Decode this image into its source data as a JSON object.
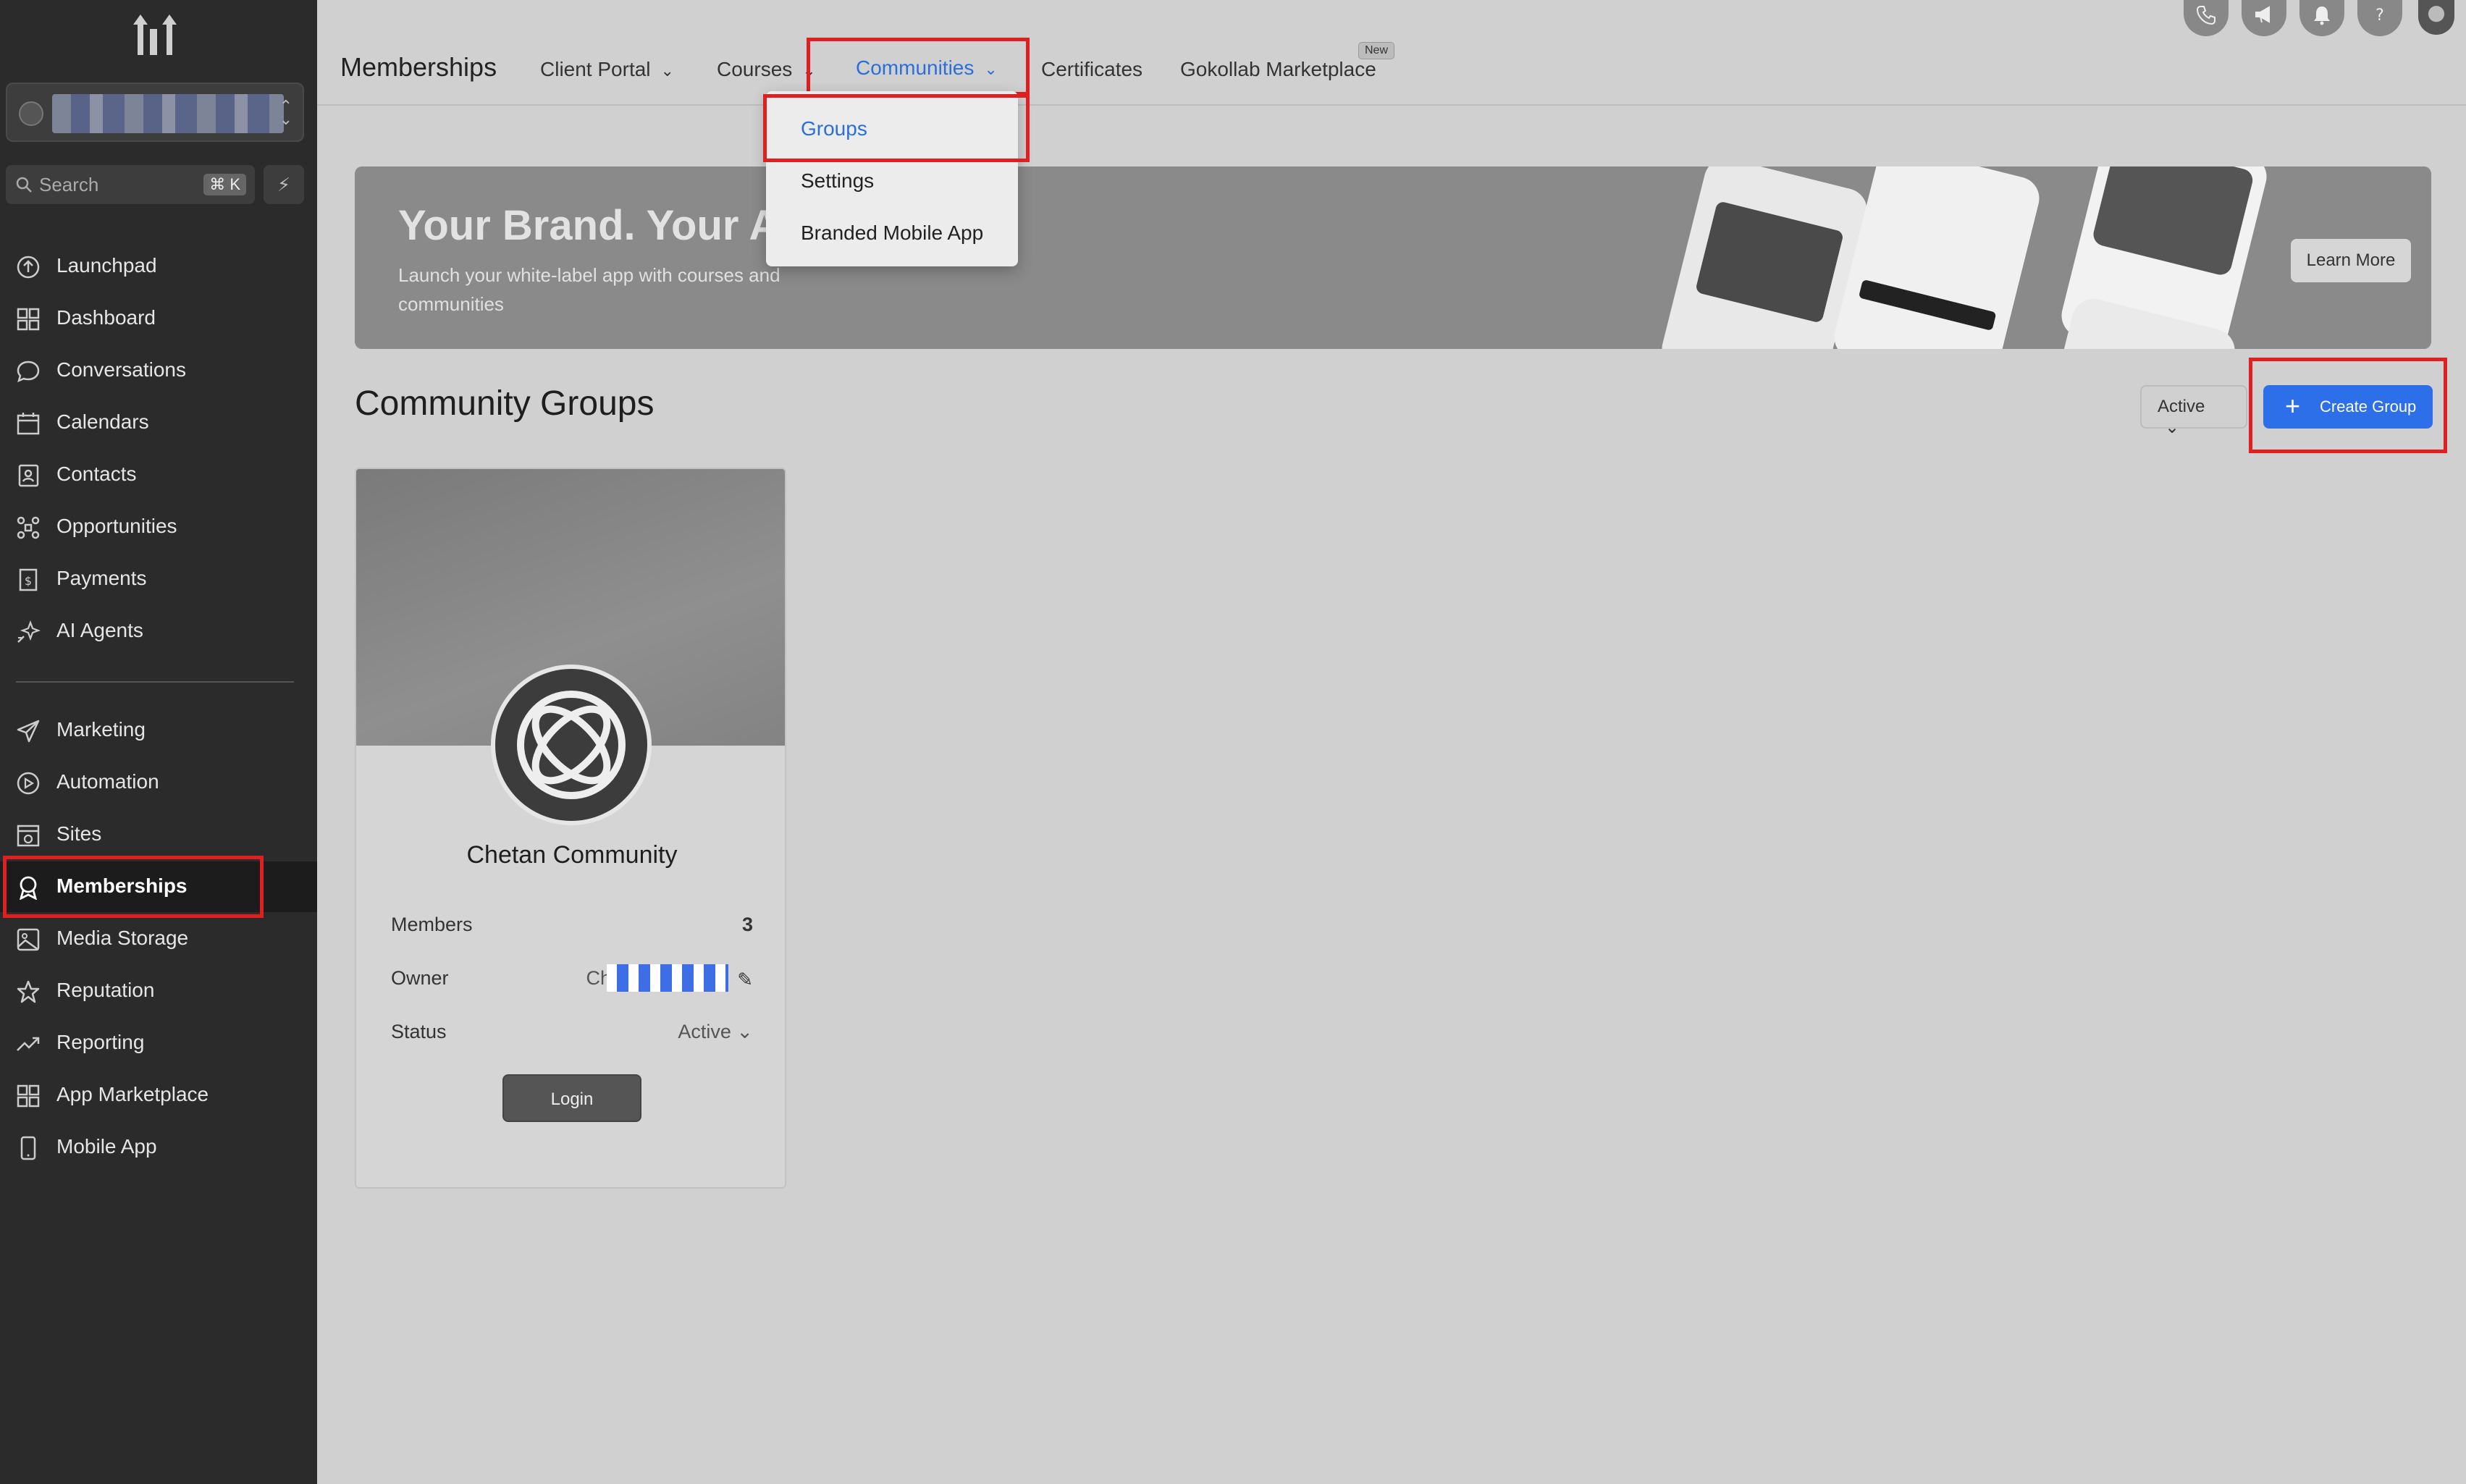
{
  "sidebar": {
    "search_placeholder": "Search",
    "search_shortcut": "⌘ K",
    "items": [
      {
        "label": "Launchpad",
        "icon": "launchpad-icon"
      },
      {
        "label": "Dashboard",
        "icon": "dashboard-icon"
      },
      {
        "label": "Conversations",
        "icon": "chat-icon"
      },
      {
        "label": "Calendars",
        "icon": "calendar-icon"
      },
      {
        "label": "Contacts",
        "icon": "contacts-icon"
      },
      {
        "label": "Opportunities",
        "icon": "opportunities-icon"
      },
      {
        "label": "Payments",
        "icon": "payments-icon"
      },
      {
        "label": "AI Agents",
        "icon": "ai-agents-icon"
      },
      {
        "label": "Marketing",
        "icon": "send-icon"
      },
      {
        "label": "Automation",
        "icon": "automation-icon"
      },
      {
        "label": "Sites",
        "icon": "sites-icon"
      },
      {
        "label": "Memberships",
        "icon": "award-icon",
        "active": true
      },
      {
        "label": "Media Storage",
        "icon": "image-icon"
      },
      {
        "label": "Reputation",
        "icon": "star-icon"
      },
      {
        "label": "Reporting",
        "icon": "trend-icon"
      },
      {
        "label": "App Marketplace",
        "icon": "grid-icon"
      },
      {
        "label": "Mobile App",
        "icon": "mobile-icon"
      }
    ]
  },
  "header": {
    "title": "Memberships",
    "tabs": [
      {
        "label": "Client Portal"
      },
      {
        "label": "Courses"
      },
      {
        "label": "Communities",
        "selected": true
      },
      {
        "label": "Certificates"
      },
      {
        "label": "Gokollab Marketplace",
        "badge": "New"
      }
    ]
  },
  "dropdown": {
    "items": [
      {
        "label": "Groups",
        "selected": true
      },
      {
        "label": "Settings"
      },
      {
        "label": "Branded Mobile App"
      }
    ]
  },
  "banner": {
    "title": "Your Brand. Your App",
    "subtitle": "Launch your white-label app with courses and communities",
    "cta": "Learn More"
  },
  "main": {
    "section_title": "Community Groups",
    "filter_value": "Active",
    "create_label": "Create Group",
    "groups": [
      {
        "name": "Chetan Community",
        "members_label": "Members",
        "members_count": "3",
        "owner_label": "Owner",
        "owner_prefix": "Ch",
        "status_label": "Status",
        "status_value": "Active",
        "login_label": "Login"
      }
    ]
  },
  "colors": {
    "accent": "#2d6fe8",
    "highlight": "#e02020",
    "sidebar_bg": "#2b2b2b"
  }
}
